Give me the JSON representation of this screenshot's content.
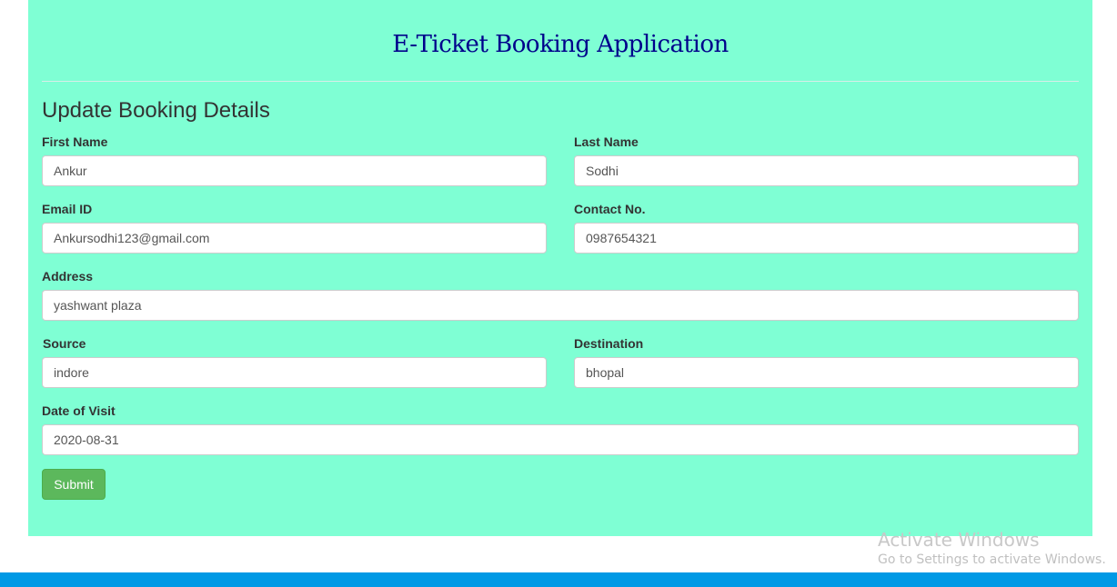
{
  "header": {
    "app_title": "E-Ticket Booking Application"
  },
  "form": {
    "title": "Update Booking Details",
    "fields": {
      "first_name": {
        "label": "First Name",
        "value": "Ankur"
      },
      "last_name": {
        "label": "Last Name",
        "value": "Sodhi"
      },
      "email": {
        "label": "Email ID",
        "value": "Ankursodhi123@gmail.com"
      },
      "contact": {
        "label": "Contact No.",
        "value": "0987654321"
      },
      "address": {
        "label": "Address",
        "value": "yashwant plaza"
      },
      "source": {
        "label": "Source",
        "value": "indore"
      },
      "destination": {
        "label": "Destination",
        "value": "bhopal"
      },
      "date_of_visit": {
        "label": "Date of Visit",
        "value": "2020-08-31"
      }
    },
    "submit_label": "Submit"
  },
  "watermark": {
    "title": "Activate Windows",
    "subtitle": "Go to Settings to activate Windows."
  },
  "colors": {
    "panel_background": "#7fffd4",
    "title_color": "#00008b",
    "submit_background": "#5cb85c",
    "taskbar": "#0099e5"
  }
}
